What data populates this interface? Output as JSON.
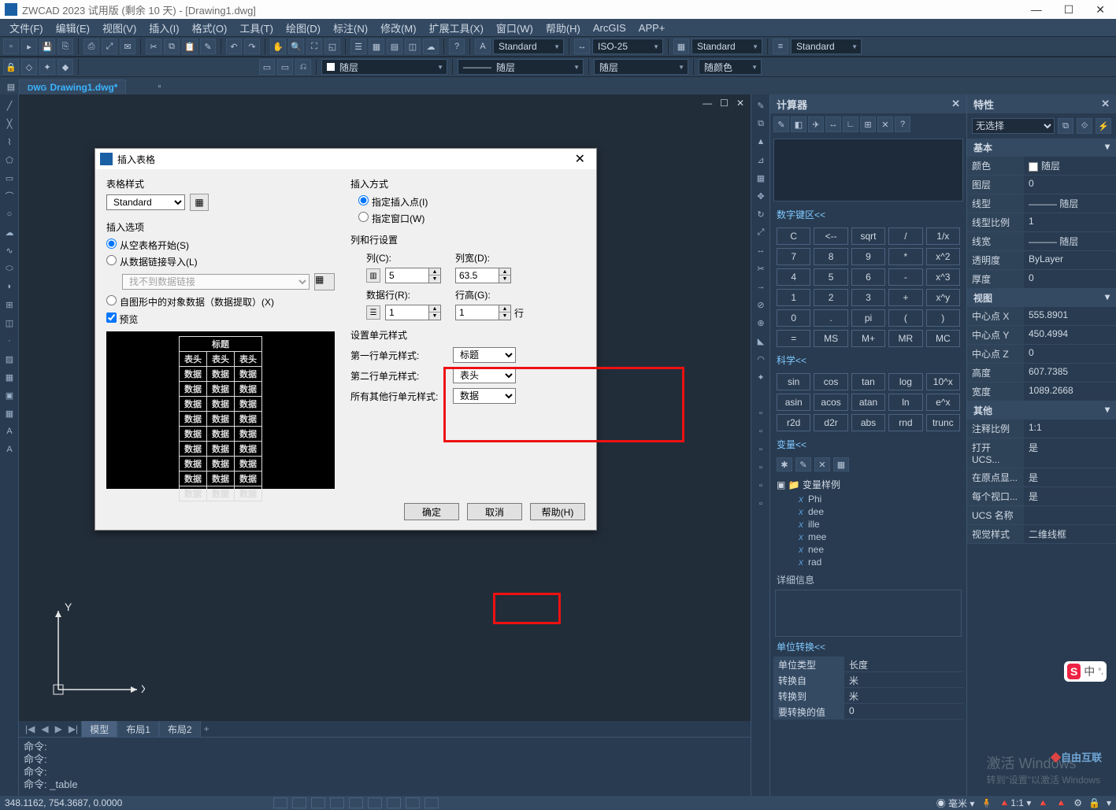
{
  "title": "ZWCAD 2023 试用版 (剩余 10 天) - [Drawing1.dwg]",
  "win": {
    "min": "—",
    "max": "☐",
    "close": "✕"
  },
  "menu": [
    "文件(F)",
    "编辑(E)",
    "视图(V)",
    "插入(I)",
    "格式(O)",
    "工具(T)",
    "绘图(D)",
    "标注(N)",
    "修改(M)",
    "扩展工具(X)",
    "窗口(W)",
    "帮助(H)",
    "ArcGIS",
    "APP+"
  ],
  "combos1": {
    "tstyle": "Standard",
    "dimstyle": "ISO-25",
    "mstyle": "Standard",
    "mlstyle": "Standard"
  },
  "combos2": {
    "layer": "随层",
    "ltype": "随层",
    "lweight": "随层",
    "color": "随颜色"
  },
  "tab": "Drawing1.dwg*",
  "canvas_tabs": {
    "nav": [
      "|◀",
      "◀",
      "▶",
      "▶|"
    ],
    "items": [
      "模型",
      "布局1",
      "布局2"
    ],
    "plus": "+"
  },
  "cmd": {
    "l1": "命令:",
    "l2": "命令:",
    "l3": "命令:",
    "l4": "命令: _table"
  },
  "calc": {
    "title": "计算器",
    "numpad_hdr": "数字键区<<",
    "keys": [
      [
        "C",
        "<--",
        "sqrt",
        "/",
        "1/x"
      ],
      [
        "7",
        "8",
        "9",
        "*",
        "x^2"
      ],
      [
        "4",
        "5",
        "6",
        "-",
        "x^3"
      ],
      [
        "1",
        "2",
        "3",
        "+",
        "x^y"
      ],
      [
        "0",
        ".",
        "pi",
        "(",
        ")"
      ],
      [
        "=",
        "MS",
        "M+",
        "MR",
        "MC"
      ]
    ],
    "sci_hdr": "科学<<",
    "sci": [
      [
        "sin",
        "cos",
        "tan",
        "log",
        "10^x"
      ],
      [
        "asin",
        "acos",
        "atan",
        "ln",
        "e^x"
      ],
      [
        "r2d",
        "d2r",
        "abs",
        "rnd",
        "trunc"
      ]
    ],
    "var_hdr": "变量<<",
    "var_folder": "变量样例",
    "vars": [
      "Phi",
      "dee",
      "ille",
      "mee",
      "nee",
      "rad"
    ],
    "detail": "详细信息",
    "unit_hdr": "单位转换<<",
    "unit_rows": [
      [
        "单位类型",
        "长度"
      ],
      [
        "转换自",
        "米"
      ],
      [
        "转换到",
        "米"
      ],
      [
        "要转换的值",
        "0"
      ]
    ]
  },
  "prop": {
    "title": "特性",
    "sel": "无选择",
    "sects": [
      {
        "hdr": "基本",
        "rows": [
          [
            "颜色",
            "随层"
          ],
          [
            "图层",
            "0"
          ],
          [
            "线型",
            "随层"
          ],
          [
            "线型比例",
            "1"
          ],
          [
            "线宽",
            "随层"
          ],
          [
            "透明度",
            "ByLayer"
          ],
          [
            "厚度",
            "0"
          ]
        ]
      },
      {
        "hdr": "视图",
        "rows": [
          [
            "中心点 X",
            "555.8901"
          ],
          [
            "中心点 Y",
            "450.4994"
          ],
          [
            "中心点 Z",
            "0"
          ],
          [
            "高度",
            "607.7385"
          ],
          [
            "宽度",
            "1089.2668"
          ]
        ]
      },
      {
        "hdr": "其他",
        "rows": [
          [
            "注释比例",
            "1:1"
          ],
          [
            "打开 UCS...",
            "是"
          ],
          [
            "在原点显...",
            "是"
          ],
          [
            "每个视口...",
            "是"
          ],
          [
            "UCS 名称",
            ""
          ],
          [
            "视觉样式",
            "二维线框"
          ]
        ]
      }
    ]
  },
  "dlg": {
    "title": "插入表格",
    "table_style_label": "表格样式",
    "table_style": "Standard",
    "insert_opts_label": "插入选项",
    "opt_empty": "从空表格开始(S)",
    "opt_link": "从数据链接导入(L)",
    "link_sel": "找不到数据链接",
    "opt_extract": "自图形中的对象数据（数据提取）(X)",
    "preview_label": "预览",
    "preview": {
      "title": "标题",
      "hdr": "表头",
      "cell": "数据"
    },
    "insert_method_label": "插入方式",
    "im_point": "指定插入点(I)",
    "im_window": "指定窗口(W)",
    "colrow_label": "列和行设置",
    "col_label": "列(C):",
    "col_val": "5",
    "colw_label": "列宽(D):",
    "colw_val": "63.5",
    "row_label": "数据行(R):",
    "row_val": "1",
    "rowh_label": "行高(G):",
    "rowh_val": "1",
    "rowh_unit": "行",
    "cellstyle_label": "设置单元样式",
    "cs1_label": "第一行单元样式:",
    "cs1": "标题",
    "cs2_label": "第二行单元样式:",
    "cs2": "表头",
    "cs3_label": "所有其他行单元样式:",
    "cs3": "数据",
    "ok": "确定",
    "cancel": "取消",
    "help": "帮助(H)"
  },
  "status": {
    "coords": "348.1162, 754.3687, 0.0000",
    "units": "毫米"
  },
  "watermark": {
    "title": "激活 Windows",
    "sub": "转到\"设置\"以激活 Windows"
  },
  "footer_logo": "自由互联",
  "badge": "中"
}
